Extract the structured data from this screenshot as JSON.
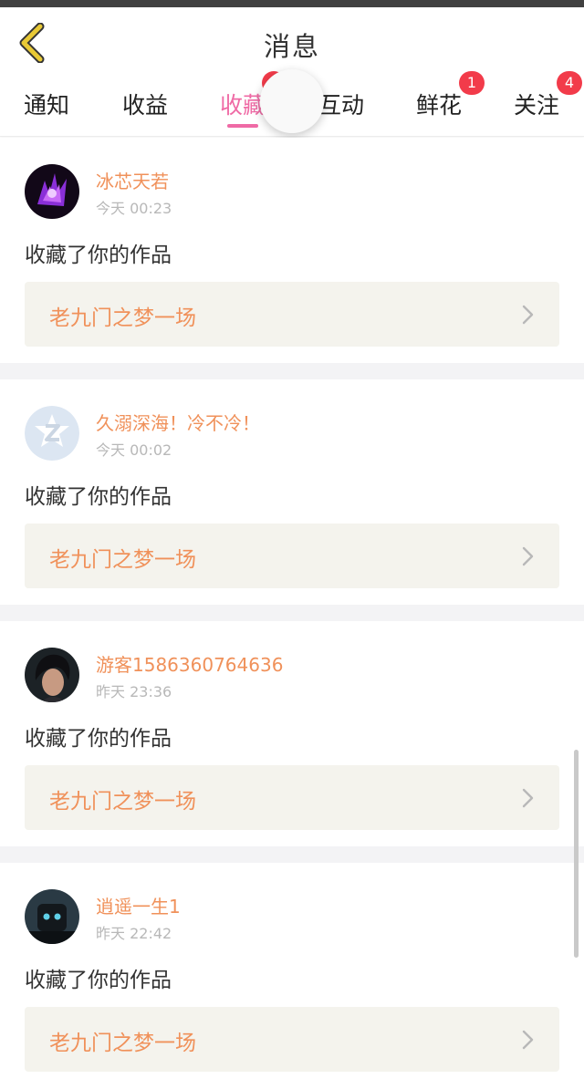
{
  "header": {
    "title": "消息",
    "back_icon": "chevron-left-icon",
    "back_icon_color": "#e8c936"
  },
  "tabs": [
    {
      "label": "通知",
      "badge": ""
    },
    {
      "label": "收益",
      "badge": ""
    },
    {
      "label": "收藏",
      "badge": "",
      "active": true
    },
    {
      "label": "互动",
      "badge": ""
    },
    {
      "label": "鲜花",
      "badge": "1"
    },
    {
      "label": "关注",
      "badge": "4"
    }
  ],
  "colors": {
    "accent_pink": "#ef6aa5",
    "name_orange": "#f0915a",
    "badge_red": "#f23b4a",
    "work_box_bg": "#f4f3ed"
  },
  "messages": [
    {
      "user": "冰芯天若",
      "time": "今天 00:23",
      "action": "收藏了你的作品",
      "work": "老九门之梦一场",
      "avatar": "purple-art-avatar"
    },
    {
      "user": "久溺深海！冷不冷！",
      "time": "今天 00:02",
      "action": "收藏了你的作品",
      "work": "老九门之梦一场",
      "avatar": "default-z-avatar"
    },
    {
      "user": "游客1586360764636",
      "time": "昨天 23:36",
      "action": "收藏了你的作品",
      "work": "老九门之梦一场",
      "avatar": "portrait-avatar"
    },
    {
      "user": "逍遥一生1",
      "time": "昨天 22:42",
      "action": "收藏了你的作品",
      "work": "老九门之梦一场",
      "avatar": "dark-character-avatar"
    }
  ]
}
